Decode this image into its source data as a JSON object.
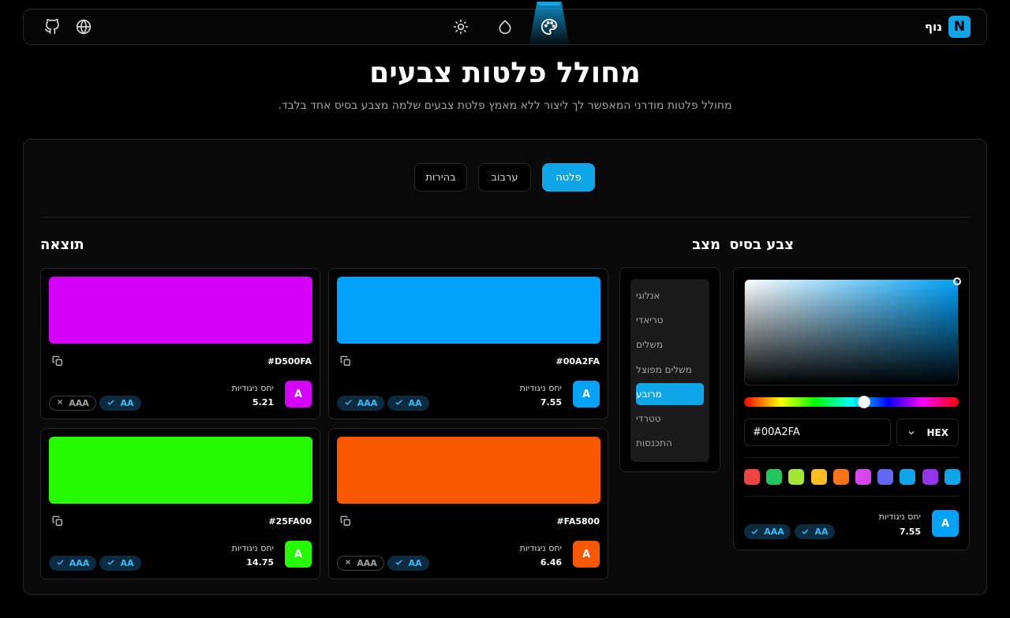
{
  "nav": {
    "brand_name": "נוף",
    "brand_letter": "N",
    "icons": [
      "github-icon",
      "globe-icon",
      "sun-icon",
      "droplet-icon",
      "palette-icon"
    ]
  },
  "header": {
    "title": "מחולל פלטות צבעים",
    "subtitle": "מחולל פלטות מודרני המאפשר לך ליצור ללא מאמץ פלטת צבעים שלמה מצבע בסיס אחד בלבד."
  },
  "tabs": [
    {
      "label": "פלטה",
      "active": true
    },
    {
      "label": "ערבוב",
      "active": false
    },
    {
      "label": "בהירות",
      "active": false
    }
  ],
  "base": {
    "title": "צבע בסיס",
    "hex_value": "#00A2FA",
    "format": "HEX",
    "swatches": [
      "#ef4444",
      "#22c55e",
      "#a3e635",
      "#fbbf24",
      "#f97316",
      "#d946ef",
      "#6366f1",
      "#0ea5e9",
      "#9333ea",
      "#0ea5e9"
    ],
    "contrast_label": "יחס ניגודיות",
    "contrast_value": "7.55",
    "avatar_letter": "A",
    "aa": "AA",
    "aaa": "AAA"
  },
  "mode": {
    "title": "מצב",
    "items": [
      "אנלוגי",
      "טריאדי",
      "משלים",
      "משלים מפוצל",
      "מרובע",
      "טטרדי",
      "התכנסות"
    ],
    "active_index": 4
  },
  "result": {
    "title": "תוצאה",
    "cards": [
      {
        "hex": "#00A2FA",
        "color": "#00A2FA",
        "label": "יחס ניגודיות",
        "value": "7.55",
        "letter": "A",
        "aa": "AA",
        "aaa": "AAA",
        "aaa_pass": true
      },
      {
        "hex": "#D500FA",
        "color": "#D500FA",
        "label": "יחס ניגודיות",
        "value": "5.21",
        "letter": "A",
        "aa": "AA",
        "aaa": "AAA",
        "aaa_pass": false
      },
      {
        "hex": "#FA5800",
        "color": "#FA5800",
        "label": "יחס ניגודיות",
        "value": "6.46",
        "letter": "A",
        "aa": "AA",
        "aaa": "AAA",
        "aaa_pass": false
      },
      {
        "hex": "#25FA00",
        "color": "#25FA00",
        "label": "יחס ניגודיות",
        "value": "14.75",
        "letter": "A",
        "aa": "AA",
        "aaa": "AAA",
        "aaa_pass": true
      }
    ]
  }
}
